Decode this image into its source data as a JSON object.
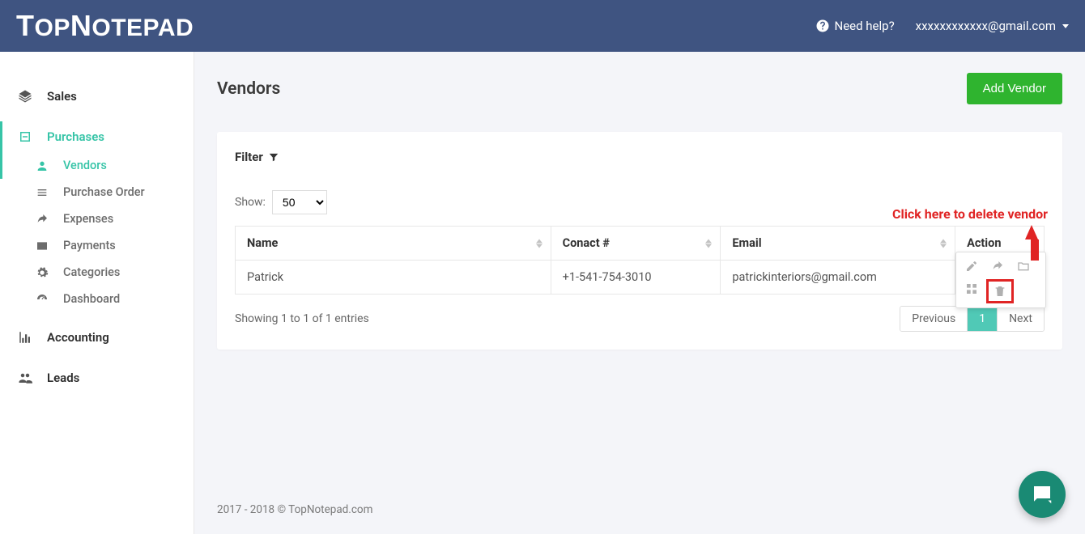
{
  "brand": "TopNotepad",
  "header": {
    "help_label": "Need help?",
    "user_email": "xxxxxxxxxxxx@gmail.com"
  },
  "sidebar": {
    "sales_label": "Sales",
    "purchases_label": "Purchases",
    "purchase_items": [
      {
        "label": "Vendors"
      },
      {
        "label": "Purchase Order"
      },
      {
        "label": "Expenses"
      },
      {
        "label": "Payments"
      },
      {
        "label": "Categories"
      },
      {
        "label": "Dashboard"
      }
    ],
    "accounting_label": "Accounting",
    "leads_label": "Leads"
  },
  "page": {
    "title": "Vendors",
    "add_button": "Add Vendor",
    "filter_label": "Filter",
    "show_label": "Show:",
    "show_options": [
      "50"
    ],
    "show_selected": "50",
    "columns": {
      "name": "Name",
      "contact": "Conact #",
      "email": "Email",
      "action": "Action"
    },
    "rows": [
      {
        "name": "Patrick",
        "contact": "+1-541-754-3010",
        "email": "patrickinteriors@gmail.com"
      }
    ],
    "showing_text": "Showing 1 to 1 of 1 entries",
    "pager": {
      "prev": "Previous",
      "page": "1",
      "next": "Next"
    }
  },
  "callout_text": "Click here to delete vendor",
  "footer_text": "2017 - 2018 © TopNotepad.com"
}
